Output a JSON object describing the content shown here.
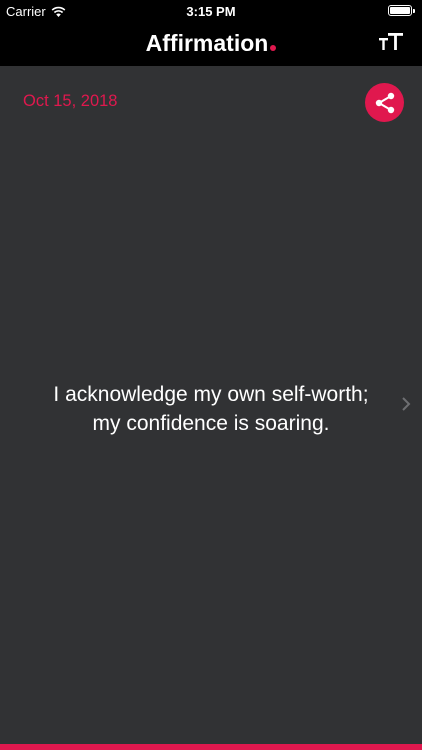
{
  "status_bar": {
    "carrier": "Carrier",
    "time": "3:15 PM",
    "wifi_icon": "wifi-icon",
    "battery_icon": "battery-icon"
  },
  "header": {
    "title": "Affirmation",
    "text_size_icon": "text-size-icon"
  },
  "entry": {
    "date": "Oct 15, 2018",
    "share_icon": "share-icon",
    "affirmation_line1": "I acknowledge my own self-worth;",
    "affirmation_line2": "my confidence is soaring.",
    "next_icon": "chevron-right-icon"
  },
  "colors": {
    "accent": "#e0184e",
    "background": "#313234",
    "header": "#000000",
    "text": "#ffffff"
  }
}
